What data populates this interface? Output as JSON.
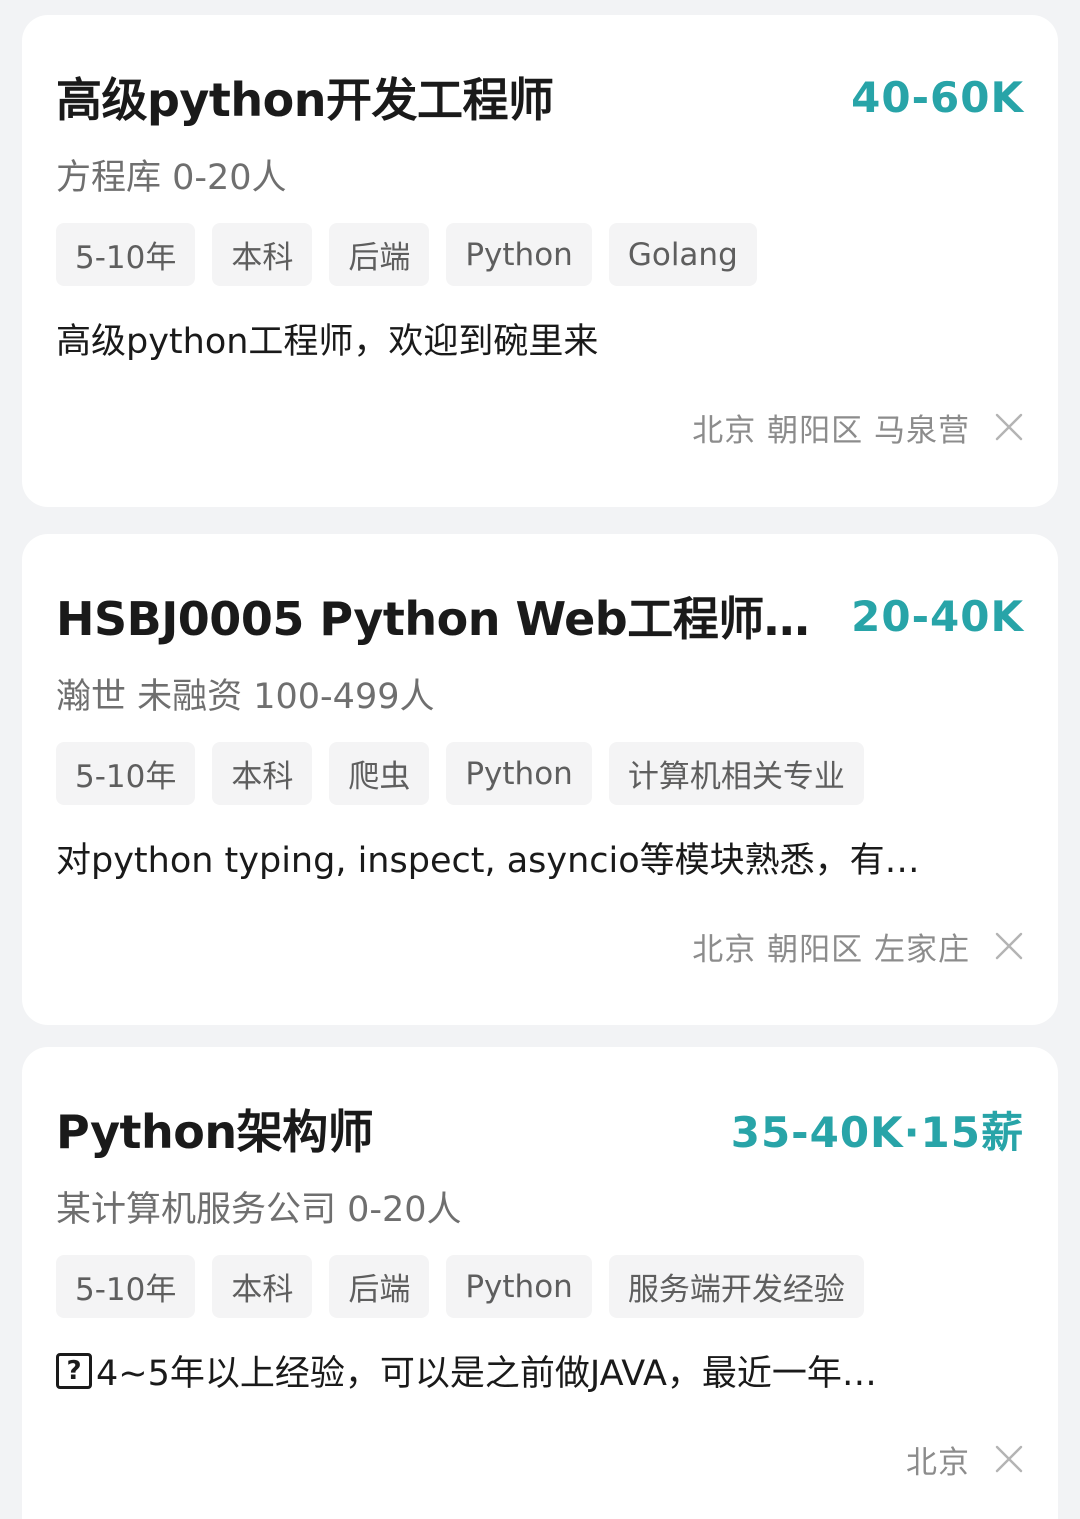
{
  "jobs": [
    {
      "title": "高级python开发工程师",
      "salary": "40-60K",
      "company": "方程库 0-20人",
      "tags": [
        "5-10年",
        "本科",
        "后端",
        "Python",
        "Golang"
      ],
      "desc_prefix_icon": "",
      "desc": "高级python工程师，欢迎到碗里来",
      "location": "北京 朝阳区 马泉营"
    },
    {
      "title": "HSBJ0005 Python Web工程师…",
      "salary": "20-40K",
      "company": "瀚世 未融资 100-499人",
      "tags": [
        "5-10年",
        "本科",
        "爬虫",
        "Python",
        "计算机相关专业"
      ],
      "desc_prefix_icon": "",
      "desc": "对python typing, inspect, asyncio等模块熟悉，有…",
      "location": "北京 朝阳区 左家庄"
    },
    {
      "title": "Python架构师",
      "salary": "35-40K·15薪",
      "company": "某计算机服务公司 0-20人",
      "tags": [
        "5-10年",
        "本科",
        "后端",
        "Python",
        "服务端开发经验"
      ],
      "desc_prefix_icon": "?",
      "desc": "4~5年以上经验，可以是之前做JAVA，最近一年…",
      "location": "北京"
    }
  ],
  "icons": {
    "dismiss": "close-icon",
    "unknown_char": "question-box-icon"
  },
  "colors": {
    "salary": "#28a4a8",
    "background": "#f2f3f5",
    "card": "#ffffff",
    "tag_bg": "#f4f4f5"
  }
}
